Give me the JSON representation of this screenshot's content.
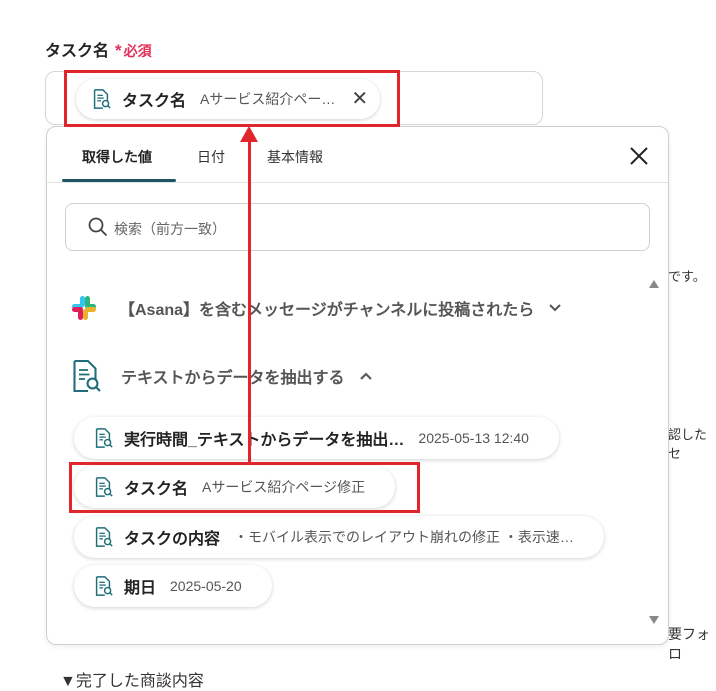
{
  "field": {
    "label": "タスク名",
    "required_star": "*",
    "required_text": "必須"
  },
  "selected_chip": {
    "name": "タスク名",
    "value": "Aサービス紹介ペー…",
    "icon": "document-search-icon",
    "remove_icon": "close-icon"
  },
  "background": {
    "text_right_1": "です。",
    "text_right_2": "認したセ",
    "text_right_3": "要フォロ",
    "bottom_label": "▼完了した商談内容"
  },
  "dropdown": {
    "tabs": [
      {
        "label": "取得した値",
        "active": true
      },
      {
        "label": "日付",
        "active": false
      },
      {
        "label": "基本情報",
        "active": false
      }
    ],
    "close_icon": "close-icon",
    "search": {
      "placeholder": "検索（前方一致）",
      "icon": "search-icon"
    },
    "sections": [
      {
        "title": "【Asana】を含むメッセージがチャンネルに投稿されたら",
        "icon": "slack-logo-icon",
        "expanded": false
      },
      {
        "title": "テキストからデータを抽出する",
        "icon": "document-search-icon",
        "expanded": true
      }
    ],
    "items": [
      {
        "name": "実行時間_テキストからデータを抽出…",
        "value": "2025-05-13 12:40"
      },
      {
        "name": "タスク名",
        "value": "Aサービス紹介ページ修正"
      },
      {
        "name": "タスクの内容",
        "value": "・モバイル表示でのレイアウト崩れの修正 ・表示速…"
      },
      {
        "name": "期日",
        "value": "2025-05-20"
      }
    ]
  },
  "annotation": {
    "color": "#e0252d"
  }
}
